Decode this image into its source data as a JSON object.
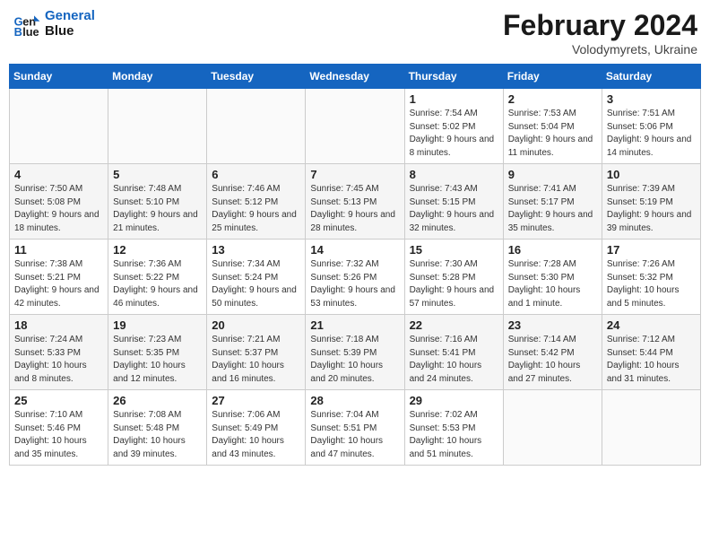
{
  "header": {
    "logo_line1": "General",
    "logo_line2": "Blue",
    "month": "February 2024",
    "location": "Volodymyrets, Ukraine"
  },
  "weekdays": [
    "Sunday",
    "Monday",
    "Tuesday",
    "Wednesday",
    "Thursday",
    "Friday",
    "Saturday"
  ],
  "weeks": [
    [
      {
        "day": "",
        "info": ""
      },
      {
        "day": "",
        "info": ""
      },
      {
        "day": "",
        "info": ""
      },
      {
        "day": "",
        "info": ""
      },
      {
        "day": "1",
        "info": "Sunrise: 7:54 AM\nSunset: 5:02 PM\nDaylight: 9 hours\nand 8 minutes."
      },
      {
        "day": "2",
        "info": "Sunrise: 7:53 AM\nSunset: 5:04 PM\nDaylight: 9 hours\nand 11 minutes."
      },
      {
        "day": "3",
        "info": "Sunrise: 7:51 AM\nSunset: 5:06 PM\nDaylight: 9 hours\nand 14 minutes."
      }
    ],
    [
      {
        "day": "4",
        "info": "Sunrise: 7:50 AM\nSunset: 5:08 PM\nDaylight: 9 hours\nand 18 minutes."
      },
      {
        "day": "5",
        "info": "Sunrise: 7:48 AM\nSunset: 5:10 PM\nDaylight: 9 hours\nand 21 minutes."
      },
      {
        "day": "6",
        "info": "Sunrise: 7:46 AM\nSunset: 5:12 PM\nDaylight: 9 hours\nand 25 minutes."
      },
      {
        "day": "7",
        "info": "Sunrise: 7:45 AM\nSunset: 5:13 PM\nDaylight: 9 hours\nand 28 minutes."
      },
      {
        "day": "8",
        "info": "Sunrise: 7:43 AM\nSunset: 5:15 PM\nDaylight: 9 hours\nand 32 minutes."
      },
      {
        "day": "9",
        "info": "Sunrise: 7:41 AM\nSunset: 5:17 PM\nDaylight: 9 hours\nand 35 minutes."
      },
      {
        "day": "10",
        "info": "Sunrise: 7:39 AM\nSunset: 5:19 PM\nDaylight: 9 hours\nand 39 minutes."
      }
    ],
    [
      {
        "day": "11",
        "info": "Sunrise: 7:38 AM\nSunset: 5:21 PM\nDaylight: 9 hours\nand 42 minutes."
      },
      {
        "day": "12",
        "info": "Sunrise: 7:36 AM\nSunset: 5:22 PM\nDaylight: 9 hours\nand 46 minutes."
      },
      {
        "day": "13",
        "info": "Sunrise: 7:34 AM\nSunset: 5:24 PM\nDaylight: 9 hours\nand 50 minutes."
      },
      {
        "day": "14",
        "info": "Sunrise: 7:32 AM\nSunset: 5:26 PM\nDaylight: 9 hours\nand 53 minutes."
      },
      {
        "day": "15",
        "info": "Sunrise: 7:30 AM\nSunset: 5:28 PM\nDaylight: 9 hours\nand 57 minutes."
      },
      {
        "day": "16",
        "info": "Sunrise: 7:28 AM\nSunset: 5:30 PM\nDaylight: 10 hours\nand 1 minute."
      },
      {
        "day": "17",
        "info": "Sunrise: 7:26 AM\nSunset: 5:32 PM\nDaylight: 10 hours\nand 5 minutes."
      }
    ],
    [
      {
        "day": "18",
        "info": "Sunrise: 7:24 AM\nSunset: 5:33 PM\nDaylight: 10 hours\nand 8 minutes."
      },
      {
        "day": "19",
        "info": "Sunrise: 7:23 AM\nSunset: 5:35 PM\nDaylight: 10 hours\nand 12 minutes."
      },
      {
        "day": "20",
        "info": "Sunrise: 7:21 AM\nSunset: 5:37 PM\nDaylight: 10 hours\nand 16 minutes."
      },
      {
        "day": "21",
        "info": "Sunrise: 7:18 AM\nSunset: 5:39 PM\nDaylight: 10 hours\nand 20 minutes."
      },
      {
        "day": "22",
        "info": "Sunrise: 7:16 AM\nSunset: 5:41 PM\nDaylight: 10 hours\nand 24 minutes."
      },
      {
        "day": "23",
        "info": "Sunrise: 7:14 AM\nSunset: 5:42 PM\nDaylight: 10 hours\nand 27 minutes."
      },
      {
        "day": "24",
        "info": "Sunrise: 7:12 AM\nSunset: 5:44 PM\nDaylight: 10 hours\nand 31 minutes."
      }
    ],
    [
      {
        "day": "25",
        "info": "Sunrise: 7:10 AM\nSunset: 5:46 PM\nDaylight: 10 hours\nand 35 minutes."
      },
      {
        "day": "26",
        "info": "Sunrise: 7:08 AM\nSunset: 5:48 PM\nDaylight: 10 hours\nand 39 minutes."
      },
      {
        "day": "27",
        "info": "Sunrise: 7:06 AM\nSunset: 5:49 PM\nDaylight: 10 hours\nand 43 minutes."
      },
      {
        "day": "28",
        "info": "Sunrise: 7:04 AM\nSunset: 5:51 PM\nDaylight: 10 hours\nand 47 minutes."
      },
      {
        "day": "29",
        "info": "Sunrise: 7:02 AM\nSunset: 5:53 PM\nDaylight: 10 hours\nand 51 minutes."
      },
      {
        "day": "",
        "info": ""
      },
      {
        "day": "",
        "info": ""
      }
    ]
  ]
}
